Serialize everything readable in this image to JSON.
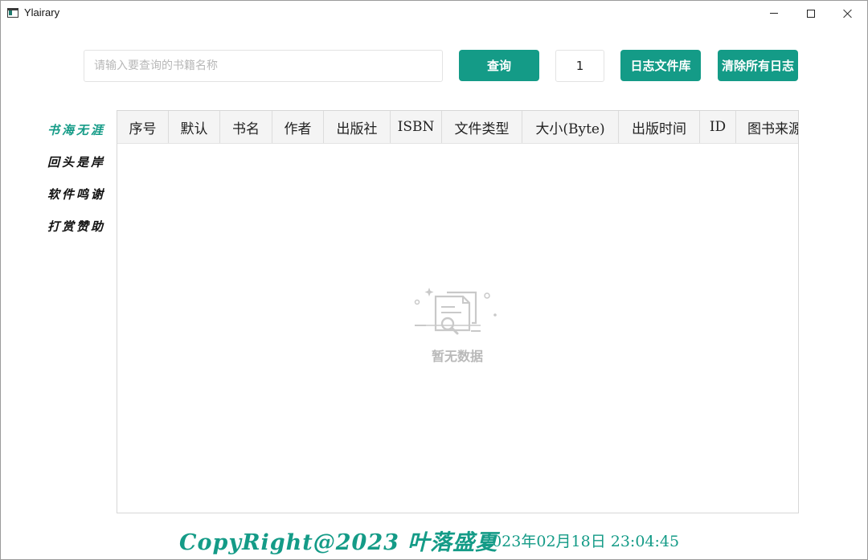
{
  "window": {
    "title": "Ylairary",
    "icon": "app-icon",
    "controls": {
      "minimize": "minimize-icon",
      "maximize": "maximize-icon",
      "close": "close-icon"
    }
  },
  "toolbar": {
    "search_placeholder": "请输入要查询的书籍名称",
    "search_value": "",
    "query_label": "查询",
    "page_number": "1",
    "logs_label": "日志文件库",
    "clear_logs_label": "清除所有日志"
  },
  "sidebar": {
    "items": [
      {
        "label": "书海无涯",
        "active": true
      },
      {
        "label": "回头是岸",
        "active": false
      },
      {
        "label": "软件鸣谢",
        "active": false
      },
      {
        "label": "打赏赞助",
        "active": false
      }
    ]
  },
  "table": {
    "columns": [
      "序号",
      "默认",
      "书名",
      "作者",
      "出版社",
      "ISBN",
      "文件类型",
      "大小(Byte)",
      "出版时间",
      "ID",
      "图书来源"
    ],
    "rows": [],
    "empty_icon": "no-data-document-search-icon",
    "empty_text": "暂无数据"
  },
  "footer": {
    "copyright": "CopyRight@2023 叶落盛夏",
    "datetime": "2023年02月18日 23:04:45"
  },
  "colors": {
    "accent": "#149b87",
    "header_bg": "#f4f4f4",
    "border": "#d7d7d7",
    "empty_text": "#b9b9b9"
  }
}
